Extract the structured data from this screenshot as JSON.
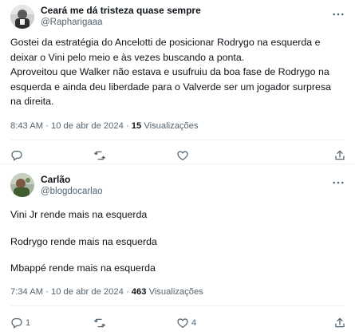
{
  "tweets": [
    {
      "display_name": "Ceará me dá tristeza quase sempre",
      "handle": "@Rapharigaaa",
      "text_lines": [
        "Gostei da estratégia do Ancelotti de posicionar Rodrygo na esquerda e",
        "deixar o Vini pelo meio e às vezes buscando a ponta.",
        "Aproveitou que Walker não estava e usufruiu da boa fase de Rodrygo na",
        "esquerda e ainda deu liberdade para o Valverde ser um jogador surpresa",
        "na direita."
      ],
      "time": "8:43 AM",
      "date": "10 de abr de 2024",
      "separator": "·",
      "views_count": "15",
      "views_label": "Visualizações",
      "actions": {
        "reply": "",
        "retweet": "",
        "like": ""
      }
    },
    {
      "display_name": "Carlão",
      "handle": "@blogdocarlao",
      "paragraphs": [
        "Vini Jr rende mais na esquerda",
        "Rodrygo rende mais na esquerda",
        "Mbappé rende mais na esquerda"
      ],
      "time": "7:34 AM",
      "date": "10 de abr de 2024",
      "separator": "·",
      "views_count": "463",
      "views_label": "Visualizações",
      "actions": {
        "reply": "1",
        "retweet": "",
        "like": "4"
      }
    }
  ],
  "icons": {
    "more": "more-horizontal-icon",
    "reply": "reply-icon",
    "retweet": "retweet-icon",
    "like": "heart-icon",
    "share": "share-icon"
  },
  "colors": {
    "text": "#0f1419",
    "secondary": "#536471",
    "border": "#eff3f4"
  }
}
